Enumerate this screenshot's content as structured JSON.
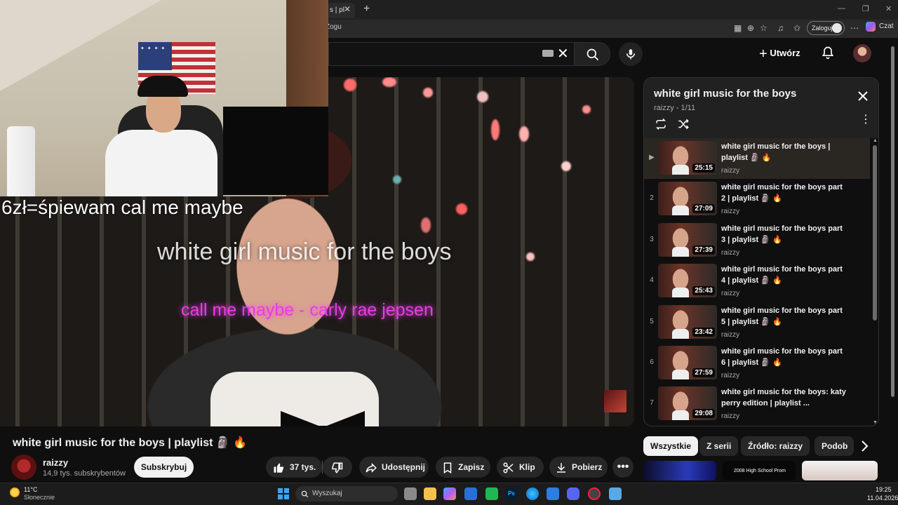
{
  "browser": {
    "tab_title": "s | pl",
    "url_text": "Zogu",
    "login_label": "Zaloguj",
    "copilot_label": "Czat"
  },
  "header": {
    "create_label": "Utwórz"
  },
  "video": {
    "overlay_title": "white girl music for the boys",
    "overlay_song": "call me maybe - carly rae jepsen",
    "webcam_caption": "6zł=śpiewam cal me maybe"
  },
  "info": {
    "title": "white girl music for the boys | playlist 🗿 🔥",
    "channel": "raizzy",
    "subscribers": "14,9 tys. subskrybentów",
    "subscribe_label": "Subskrybuj",
    "likes": "37 tys.",
    "share_label": "Udostępnij",
    "save_label": "Zapisz",
    "clip_label": "Klip",
    "download_label": "Pobierz"
  },
  "playlist": {
    "title": "white girl music for the boys",
    "meta": "raizzy - 1/11",
    "items": [
      {
        "index": "▶",
        "title": "white girl music for the boys | playlist 🗿 🔥",
        "channel": "raizzy",
        "duration": "25:15"
      },
      {
        "index": "2",
        "title": "white girl music for the boys part 2 | playlist 🗿 🔥",
        "channel": "raizzy",
        "duration": "27:09"
      },
      {
        "index": "3",
        "title": "white girl music for the boys part 3 | playlist 🗿 🔥",
        "channel": "raizzy",
        "duration": "27:39"
      },
      {
        "index": "4",
        "title": "white girl music for the boys part 4 | playlist 🗿 🔥",
        "channel": "raizzy",
        "duration": "25:43"
      },
      {
        "index": "5",
        "title": "white girl music for the boys part 5 | playlist 🗿 🔥",
        "channel": "raizzy",
        "duration": "23:42"
      },
      {
        "index": "6",
        "title": "white girl music for the boys part 6 | playlist 🗿 🔥",
        "channel": "raizzy",
        "duration": "27:59"
      },
      {
        "index": "7",
        "title": "white girl music for the boys: katy perry edition | playlist ...",
        "channel": "raizzy",
        "duration": "29:08"
      }
    ]
  },
  "chips": {
    "all": "Wszystkie",
    "series": "Z serii",
    "source": "Źródło: raizzy",
    "similar": "Podob"
  },
  "recommendations": {
    "second_caption": "2008 High School Prom"
  },
  "taskbar": {
    "temp": "11°C",
    "weather": "Słonecznie",
    "search_placeholder": "Wyszukaj",
    "time": "19:25",
    "date": "11.04.2026"
  },
  "colors": {
    "accent_red": "#ff0000",
    "overlay_magenta": "#e63ee0",
    "background": "#0f0f0f"
  }
}
